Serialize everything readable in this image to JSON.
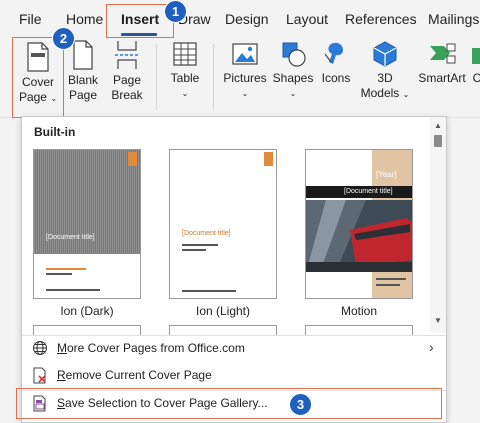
{
  "tabs": [
    {
      "label": "File"
    },
    {
      "label": "Home"
    },
    {
      "label": "Insert"
    },
    {
      "label": "Draw"
    },
    {
      "label": "Design"
    },
    {
      "label": "Layout"
    },
    {
      "label": "References"
    },
    {
      "label": "Mailings"
    }
  ],
  "steps": [
    "1",
    "2",
    "3"
  ],
  "ribbon": {
    "cover_page": {
      "line1": "Cover",
      "line2": "Page"
    },
    "blank_page": {
      "line1": "Blank",
      "line2": "Page"
    },
    "page_break": {
      "line1": "Page",
      "line2": "Break"
    },
    "table": {
      "line1": "Table"
    },
    "pictures": {
      "line1": "Pictures"
    },
    "shapes": {
      "line1": "Shapes"
    },
    "icons": {
      "line1": "Icons"
    },
    "models3d": {
      "line1": "3D",
      "line2": "Models"
    },
    "smartart": {
      "line1": "SmartArt"
    },
    "chart": {
      "line1": "C"
    }
  },
  "gallery": {
    "section_title": "Built-in",
    "items": [
      {
        "caption": "Ion (Dark)",
        "doc_title": "[Document title]"
      },
      {
        "caption": "Ion (Light)",
        "doc_title": "[Document title]"
      },
      {
        "caption": "Motion",
        "doc_title": "[Document title]",
        "year": "[Year]"
      }
    ]
  },
  "menu": {
    "more": {
      "prefix": "",
      "accel": "M",
      "rest": "ore Cover Pages from Office.com"
    },
    "remove": {
      "prefix": "",
      "accel": "R",
      "rest": "emove Current Cover Page"
    },
    "save": {
      "prefix": "",
      "accel": "S",
      "rest": "ave Selection to Cover Page Gallery..."
    }
  },
  "colors": {
    "accent": "#2b579a",
    "highlight": "#e07050",
    "step_badge": "#1f5fbf"
  }
}
